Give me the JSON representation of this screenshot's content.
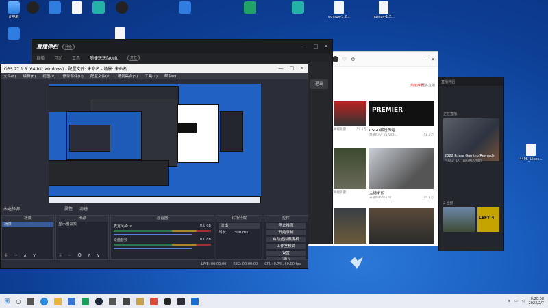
{
  "desktop": {
    "icons": [
      {
        "label": "此电脑",
        "kind": "pc"
      },
      {
        "label": "",
        "kind": "app-dark"
      },
      {
        "label": "",
        "kind": "app-blue"
      },
      {
        "label": "",
        "kind": "doc"
      },
      {
        "label": "",
        "kind": "app-teal"
      },
      {
        "label": "",
        "kind": "app-dark"
      },
      {
        "label": "",
        "kind": "app-blue"
      },
      {
        "label": "",
        "kind": "xls"
      },
      {
        "label": "",
        "kind": "app-teal"
      },
      {
        "label": "numpy-1.2...",
        "kind": "doc"
      },
      {
        "label": "numpy-1.2...",
        "kind": "doc"
      },
      {
        "label": "",
        "kind": "app-blue"
      },
      {
        "label": "",
        "kind": "doc"
      },
      {
        "label": "4495_Ulsec...",
        "kind": "doc"
      }
    ]
  },
  "live_window": {
    "brand": "直播伴侣",
    "badge": "升级",
    "tab_title": "随便玩玩faceit",
    "tab_badge": "开放",
    "tabs": [
      "直播",
      "互动",
      "工具"
    ],
    "side_btn": "退出",
    "win_ctrls": [
      "—",
      "□",
      "✕"
    ]
  },
  "obs": {
    "title": "OBS 27.1.3 (64-bit, windows) - 配置文件: 未命名 - 场景: 未命名",
    "menu": [
      "文件(F)",
      "编辑(E)",
      "视图(V)",
      "停靠部件(D)",
      "配置文件(P)",
      "场景集合(S)",
      "工具(T)",
      "帮助(H)"
    ],
    "below_preview": [
      "未选择源",
      "属性",
      "滤镜"
    ],
    "docks": {
      "scenes": {
        "title": "场景",
        "items": [
          "场景"
        ]
      },
      "sources": {
        "title": "来源",
        "items": [
          "显示器采集"
        ]
      },
      "mixer": {
        "title": "混音器",
        "channels": [
          {
            "name": "麦克风/Aux",
            "db": "0.0 dB"
          },
          {
            "name": "桌面音频",
            "db": "0.0 dB"
          }
        ]
      },
      "transitions": {
        "title": "转场特效",
        "mode": "淡出",
        "duration_label": "时长",
        "duration": "300 ms"
      },
      "controls": {
        "title": "控件",
        "buttons": [
          "停止推流",
          "开始录制",
          "启动虚拟摄像机",
          "工作室模式",
          "设置",
          "退出"
        ]
      }
    },
    "status": [
      "LIVE: 00:00:00",
      "REC: 00:00:00",
      "CPU: 0.7%, 60.00 fps"
    ]
  },
  "browser": {
    "hot_label": "热度推荐",
    "more_label": "更多直播",
    "cards": [
      {
        "title": "",
        "meta_left": "高端联盟",
        "meta_right": "59.6万"
      },
      {
        "title": "CSGO解说传哈",
        "meta_left": "直播Navi VS Vital...",
        "meta_right": "58.6万"
      },
      {
        "title": "",
        "meta_left": "高端联盟",
        "meta_right": ""
      },
      {
        "title": "主播米丽",
        "meta_left": "米丽Kirbdo520",
        "meta_right": "20.5万"
      }
    ],
    "banner_text": "PREMIER"
  },
  "dark_window": {
    "title": "直播伴侣",
    "section1": "正在直播",
    "card1_caption": "2022 Prime Gaming Rewards",
    "card1_sub": "PUBG: BATTLEGROUNDS",
    "section2": "2 全部",
    "card2_text": "LEFT 4"
  },
  "taskbar": {
    "time": "0:20:08",
    "date": "2022/2/7"
  }
}
